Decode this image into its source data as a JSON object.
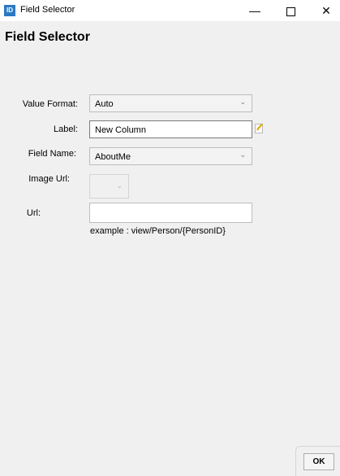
{
  "window": {
    "icon_text": "ID",
    "title": "Field Selector",
    "minimize": "—",
    "close": "✕"
  },
  "page": {
    "title": "Field Selector"
  },
  "form": {
    "value_format": {
      "label": "Value Format:",
      "value": "Auto"
    },
    "label_field": {
      "label": "Label:",
      "value": "New Column"
    },
    "field_name": {
      "label": "Field Name:",
      "value": "AboutMe"
    },
    "image_url": {
      "label": "Image Url:",
      "value": ""
    },
    "url": {
      "label": "Url:",
      "value": "",
      "example": "example : view/Person/{PersonID}"
    }
  },
  "icons": {
    "dropdown": "chevron-down-icon",
    "edit": "edit-icon"
  },
  "chevron_glyph": "⌄",
  "buttons": {
    "ok": "OK"
  },
  "colors": {
    "app_icon": "#2b79c2",
    "background": "#f0f0f0"
  }
}
